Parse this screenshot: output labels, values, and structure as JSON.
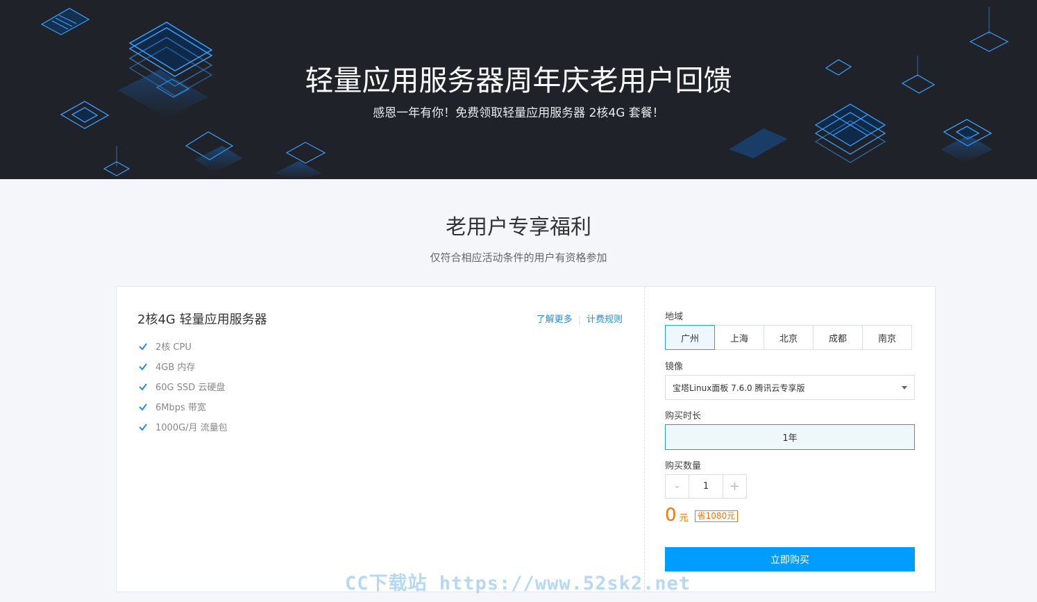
{
  "hero": {
    "title": "轻量应用服务器周年庆老用户回馈",
    "subtitle": "感恩一年有你！免费领取轻量应用服务器 2核4G 套餐！"
  },
  "section": {
    "title": "老用户专享福利",
    "subtitle": "仅符合相应活动条件的用户有资格参加"
  },
  "product": {
    "name": "2核4G 轻量应用服务器",
    "links": [
      "了解更多",
      "计费规则"
    ],
    "features": [
      "2核 CPU",
      "4GB 内存",
      "60G SSD 云硬盘",
      "6Mbps 带宽",
      "1000G/月 流量包"
    ]
  },
  "form": {
    "region_label": "地域",
    "regions": [
      "广州",
      "上海",
      "北京",
      "成都",
      "南京"
    ],
    "selected_region": "广州",
    "image_label": "镜像",
    "image_value": "宝塔Linux面板 7.6.0 腾讯云专享版",
    "duration_label": "购买时长",
    "duration_value": "1年",
    "quantity_label": "购买数量",
    "quantity_minus": "-",
    "quantity_value": "1",
    "quantity_plus": "+",
    "price": "0",
    "price_unit": "元",
    "savings": "省1080元",
    "buy_label": "立即购买"
  },
  "watermark": "CC下载站 https://www.52sk2.net",
  "colors": {
    "hero_bg": "#1f2229",
    "accent_blue": "#009dff",
    "link_blue": "#1f8ceb",
    "price_orange": "#ff7200",
    "duration_border": "#26a0a8"
  },
  "icons": {
    "feature": "check-icon",
    "image_select": "chevron-down-icon"
  }
}
